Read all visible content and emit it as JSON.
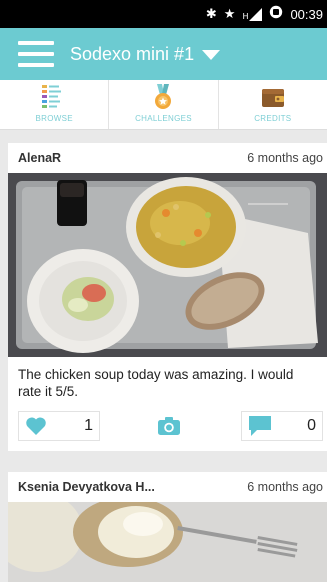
{
  "status_bar": {
    "bluetooth_icon": "bluetooth-icon",
    "star_icon": "star-icon",
    "signal_label": "H",
    "signal_icon": "signal-icon",
    "alarm_icon": "alarm-icon",
    "time": "00:39"
  },
  "app_bar": {
    "menu_icon": "hamburger-menu-icon",
    "title": "Sodexo mini #1",
    "dropdown_icon": "caret-down-icon",
    "color": "#6ccbd1"
  },
  "tabs": [
    {
      "label": "BROWSE",
      "icon": "list-icon"
    },
    {
      "label": "CHALLENGES",
      "icon": "medal-icon"
    },
    {
      "label": "CREDITS",
      "icon": "wallet-icon"
    }
  ],
  "posts": [
    {
      "author": "AlenaR",
      "time": "6 months ago",
      "photo_description": "chicken soup, salad and bread on a tray",
      "caption": "The chicken soup today was amazing. I would rate it 5/5.",
      "likes": "1",
      "comments": "0",
      "like_icon": "heart-icon",
      "camera_icon": "camera-icon",
      "comment_icon": "comment-icon"
    },
    {
      "author": "Ksenia Devyatkova H...",
      "time": "6 months ago",
      "photo_description": "food with fork on a plate"
    }
  ],
  "accent_color": "#5cc3d1"
}
